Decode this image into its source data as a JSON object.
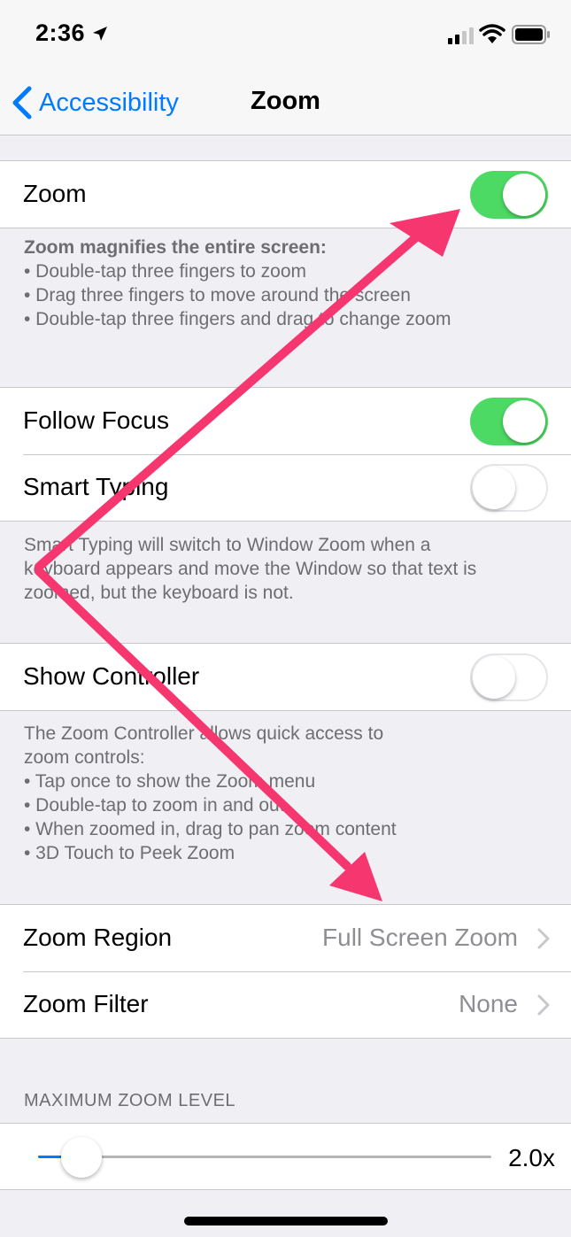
{
  "status_bar": {
    "time": "2:36",
    "icons": [
      "location-arrow-icon",
      "cellular-signal-icon",
      "wifi-icon",
      "battery-icon"
    ]
  },
  "nav": {
    "back_label": "Accessibility",
    "title": "Zoom"
  },
  "zoom_cell": {
    "label": "Zoom",
    "on": true
  },
  "zoom_footer": {
    "heading": "Zoom magnifies the entire screen:",
    "items": [
      "• Double-tap three fingers to zoom",
      "• Drag three fingers to move around the screen",
      "• Double-tap three fingers and drag to change zoom"
    ]
  },
  "follow_focus": {
    "label": "Follow Focus",
    "on": true
  },
  "smart_typing": {
    "label": "Smart Typing",
    "on": false
  },
  "smart_typing_footer": {
    "lines": [
      "Smart Typing will switch to Window Zoom when a",
      "keyboard appears and move the Window so that text is",
      "zoomed, but the keyboard is not."
    ]
  },
  "show_controller": {
    "label": "Show Controller",
    "on": false
  },
  "controller_footer": {
    "lines": [
      "The Zoom Controller allows quick access to",
      "zoom controls:",
      "• Tap once to show the Zoom menu",
      "• Double-tap to zoom in and out",
      "• When zoomed in, drag to pan zoom content",
      "• 3D Touch to Peek Zoom"
    ]
  },
  "zoom_region": {
    "label": "Zoom Region",
    "value": "Full Screen Zoom"
  },
  "zoom_filter": {
    "label": "Zoom Filter",
    "value": "None"
  },
  "max_zoom": {
    "header": "MAXIMUM ZOOM LEVEL",
    "value_label": "2.0x",
    "fraction": 0.1
  },
  "colors": {
    "accent": "#007aff",
    "switch_on": "#4cd964",
    "annotation_arrow": "#f5366f"
  }
}
